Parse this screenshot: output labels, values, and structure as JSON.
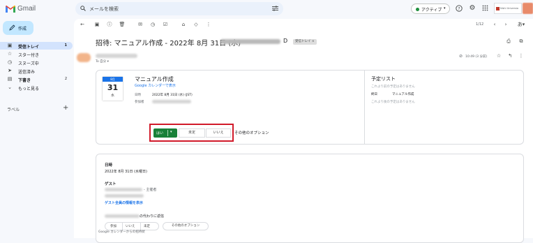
{
  "app": {
    "name": "Gmail"
  },
  "search": {
    "placeholder": "メールを検索"
  },
  "status": {
    "label": "アクティブ"
  },
  "org": {
    "label": "Nishi Universia"
  },
  "sidebar": {
    "compose": "作成",
    "items": [
      {
        "label": "受信トレイ",
        "count": "1",
        "icon": "inbox-icon"
      },
      {
        "label": "スター付き",
        "count": "",
        "icon": "star-icon"
      },
      {
        "label": "スヌーズ中",
        "count": "",
        "icon": "clock-icon"
      },
      {
        "label": "送信済み",
        "count": "",
        "icon": "send-icon"
      },
      {
        "label": "下書き",
        "count": "2",
        "icon": "draft-icon"
      },
      {
        "label": "もっと見る",
        "count": "",
        "icon": "chevron-down-icon"
      }
    ],
    "labels_title": "ラベル"
  },
  "toolbar": {
    "pager": "1/12"
  },
  "message": {
    "subject": "招待: マニュアル作成 - 2022年 8月 31日 (水)",
    "chip": "受信トレイ ×",
    "to_me": "To 自分 ▾",
    "time": "10:49 (3 分前)"
  },
  "invite": {
    "cal_month": "8月",
    "cal_day": "31",
    "cal_weekday": "水",
    "title": "マニュアル作成",
    "calendar_link": "Google カレンダーで表示",
    "date_key": "日時",
    "date_value": "2022年 8月 31日 (水) (JST)",
    "guests_key": "参加者",
    "rsvp_yes": "はい",
    "rsvp_maybe": "未定",
    "rsvp_no": "いいえ",
    "more_options": "その他のオプション"
  },
  "schedule": {
    "title": "予定リスト",
    "empty_before": "これより前の予定はありません",
    "row_key": "終日",
    "row_value": "マニュアル作成",
    "empty_after": "これより後の予定はありません"
  },
  "details": {
    "date_heading": "日時",
    "date_value": "2022年 8月 31日 (水曜日)",
    "guests_heading": "ゲスト",
    "organizer_tag": "- 主催者",
    "view_all_guests": "ゲスト全員の情報を表示",
    "reply_for_suffix": "の代わりに返信",
    "btn_yes": "参加",
    "btn_no": "いいえ",
    "btn_maybe": "未定",
    "btn_more": "その他のオプション",
    "footer": "Google カレンダーからの招待状"
  }
}
